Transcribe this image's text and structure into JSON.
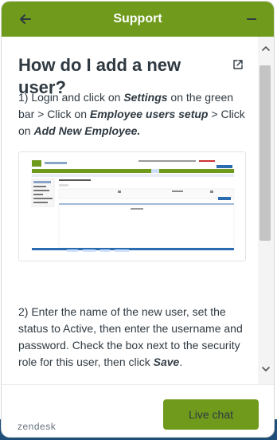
{
  "header": {
    "title": "Support",
    "back_icon": "arrow-left-icon",
    "minimize_icon": "minus-icon"
  },
  "article": {
    "title": "How do I add a new user?",
    "external_link_icon": "external-link-icon",
    "step1": {
      "prefix": "1) Login and click on ",
      "settings": "Settings",
      "middle1": " on the green bar > Click on ",
      "setup": "Employee users setup",
      "middle2": " > Click on ",
      "add": "Add New Employee."
    },
    "screenshot_icon": "settings-screenshot-image",
    "step2": {
      "text": "2) Enter the name of the new user, set the status to Active, then enter the username and password. Check the box next to the security role for this user, then click ",
      "save": "Save",
      "end": "."
    }
  },
  "footer": {
    "brand": "zendesk",
    "live_chat_label": "Live chat"
  },
  "colors": {
    "brand_green": "#6f9a1c",
    "text": "#2f3941"
  }
}
